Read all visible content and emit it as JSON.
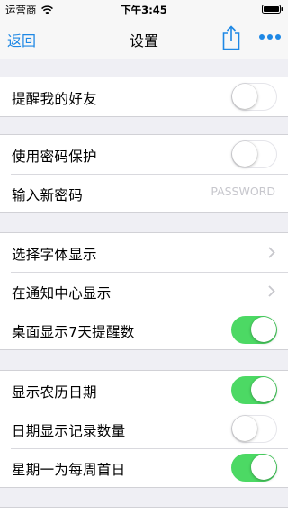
{
  "status_bar": {
    "carrier": "运营商",
    "time": "下午3:45"
  },
  "nav": {
    "back_label": "返回",
    "title": "设置",
    "share_icon": "share-icon",
    "more_icon": "more-icon"
  },
  "colors": {
    "accent": "#1e88e5",
    "toggle_on": "#4cd964",
    "background": "#efeff4"
  },
  "settings": {
    "remind_friends": {
      "label": "提醒我的好友",
      "on": false
    },
    "password_protect": {
      "label": "使用密码保护",
      "on": false
    },
    "new_password": {
      "label": "输入新密码",
      "placeholder": "PASSWORD",
      "value": ""
    },
    "font_display": {
      "label": "选择字体显示"
    },
    "notification_center": {
      "label": "在通知中心显示"
    },
    "desktop_reminder": {
      "label": "桌面显示7天提醒数",
      "on": true
    },
    "lunar_date": {
      "label": "显示农历日期",
      "on": true
    },
    "record_count": {
      "label": "日期显示记录数量",
      "on": false
    },
    "monday_first": {
      "label": "星期一为每周首日",
      "on": true
    }
  }
}
